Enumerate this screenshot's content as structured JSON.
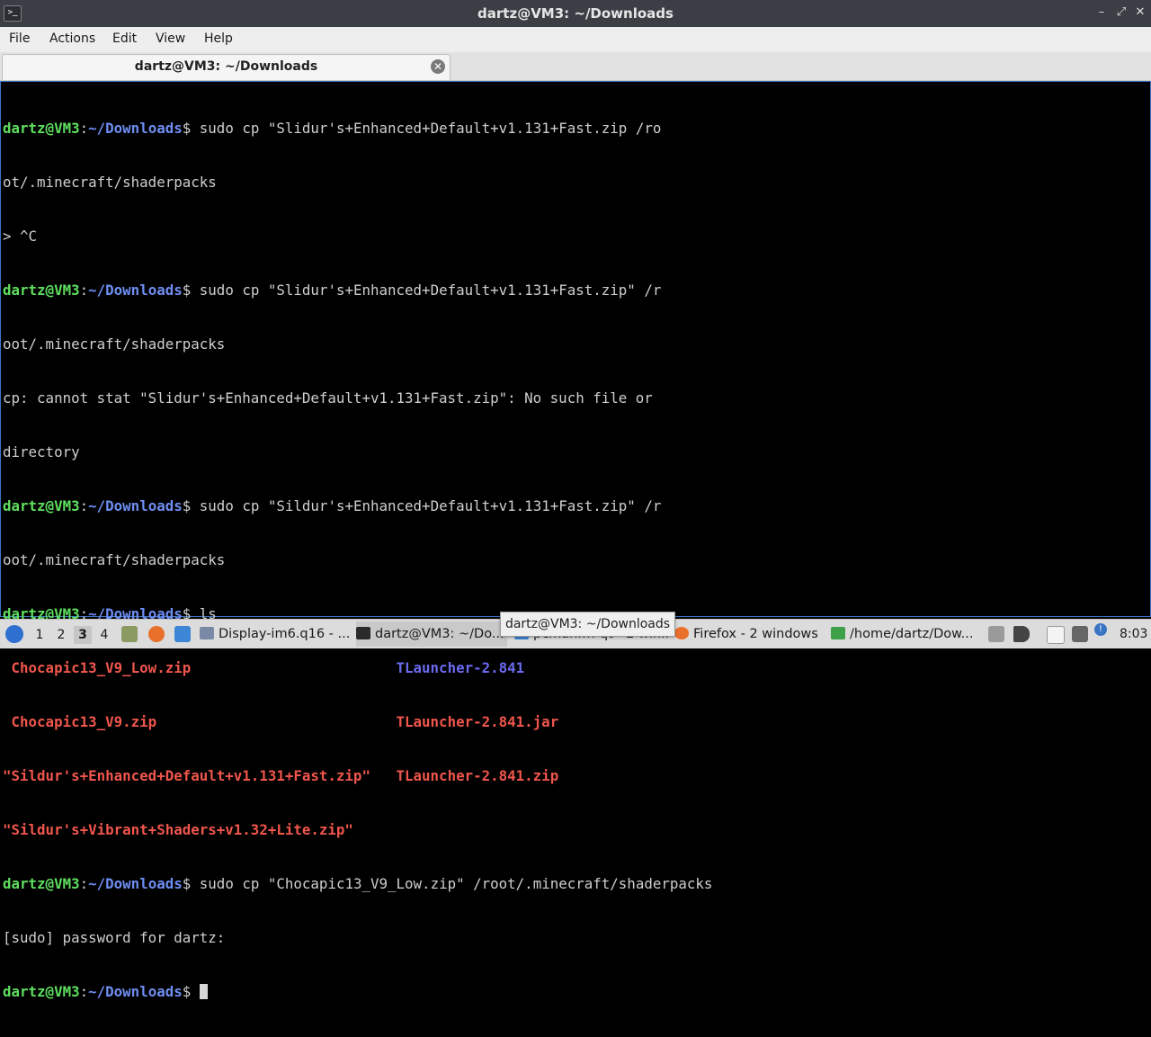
{
  "window": {
    "title": "dartz@VM3: ~/Downloads",
    "minimize": "–",
    "maximize": "⤢",
    "close": "✕",
    "app_icon": ">_"
  },
  "menu": {
    "file": "File",
    "actions": "Actions",
    "edit": "Edit",
    "view": "View",
    "help": "Help"
  },
  "tab": {
    "label": "dartz@VM3: ~/Downloads",
    "close": "✕"
  },
  "terminal": {
    "user_host": "dartz@VM3",
    "colon": ":",
    "path": "~/Downloads",
    "prompt_end": "$ ",
    "cmd1": "sudo cp \"Slidur's+Enhanced+Default+v1.131+Fast.zip /ro",
    "line2": "ot/.minecraft/shaderpacks",
    "line3": "> ^C",
    "cmd2": "sudo cp \"Slidur's+Enhanced+Default+v1.131+Fast.zip\" /r",
    "line5": "oot/.minecraft/shaderpacks",
    "line6": "cp: cannot stat \"Slidur's+Enhanced+Default+v1.131+Fast.zip\": No such file or",
    "line7": "directory",
    "cmd3": "sudo cp \"Sildur's+Enhanced+Default+v1.131+Fast.zip\" /r",
    "line9": "oot/.minecraft/shaderpacks",
    "cmd4": "ls",
    "ls1a": " Chocapic13_V9_Low.zip",
    "ls1b": "TLauncher-2.841",
    "ls2a": " Chocapic13_V9.zip",
    "ls2b": "TLauncher-2.841.jar",
    "ls3a": "\"Sildur's+Enhanced+Default+v1.131+Fast.zip\"",
    "ls3b": "TLauncher-2.841.zip",
    "ls4a": "\"Sildur's+Vibrant+Shaders+v1.32+Lite.zip\"",
    "cmd5": "sudo cp \"Chocapic13_V9_Low.zip\" /root/.minecraft/shaderpacks",
    "line16": "[sudo] password for dartz:",
    "pad1": "                        ",
    "pad2": "                            ",
    "pad3": "   "
  },
  "taskbar": {
    "ws1": "1",
    "ws2": "2",
    "ws3": "3",
    "ws4": "4",
    "task1": "Display-im6.q16 - ...",
    "task2": "dartz@VM3: ~/Do...",
    "task3": "pcmanfm-qt - 2 win...",
    "task4": "Firefox - 2 windows",
    "task5": "/home/dartz/Dow...",
    "clock": "8:03",
    "notify_badge": "!"
  },
  "tooltip": {
    "text": "dartz@VM3: ~/Downloads"
  },
  "colors": {
    "user": "#5fdf5f",
    "path": "#6f8ef2",
    "zip": "#f0564c",
    "dir": "#6a6af0",
    "accent": "#3a74c4"
  }
}
